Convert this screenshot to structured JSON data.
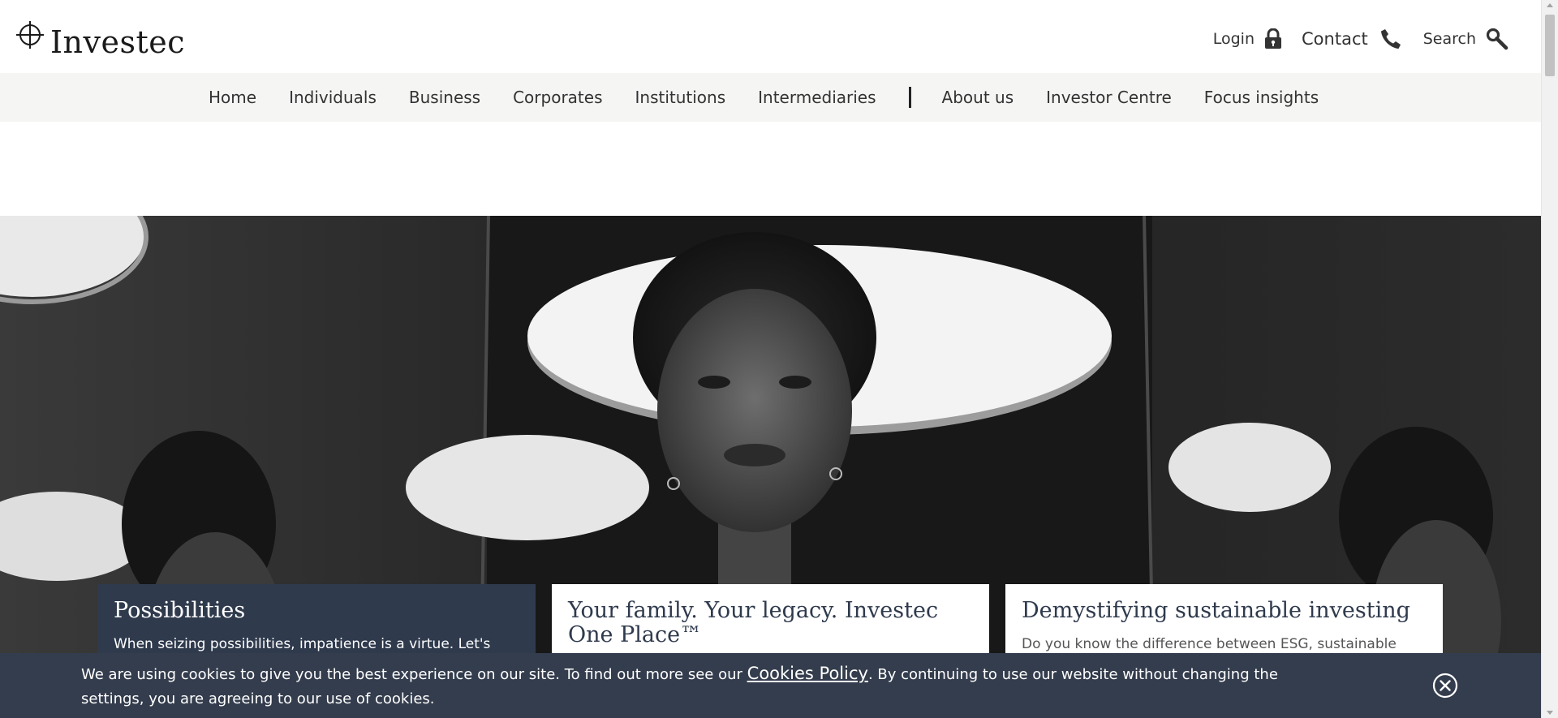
{
  "brand": {
    "name": "Investec"
  },
  "utility": {
    "login_label": "Login",
    "contact_label": "Contact",
    "search_label": "Search"
  },
  "nav": {
    "primary": [
      "Home",
      "Individuals",
      "Business",
      "Corporates",
      "Institutions",
      "Intermediaries"
    ],
    "secondary": [
      "About us",
      "Investor Centre",
      "Focus insights"
    ]
  },
  "cards": [
    {
      "title": "Possibilities",
      "body": "When seizing possibilities, impatience is a virtue. Let's"
    },
    {
      "title": "Your family. Your legacy. Investec One Place™",
      "body": ""
    },
    {
      "title": "Demystifying sustainable investing",
      "body": "Do you know the difference between ESG, sustainable"
    }
  ],
  "cookie": {
    "text_before": "We are using cookies to give you the best experience on our site. To find out more see our ",
    "link_label": "Cookies Policy",
    "text_after": ". By continuing to use our website without changing the settings, you are agreeing to our use of cookies."
  },
  "icons": {
    "logo": "crosshair-logo-icon",
    "login": "padlock-icon",
    "contact": "phone-icon",
    "search": "magnifier-icon",
    "close": "close-circle-icon"
  },
  "colors": {
    "nav_bg": "#f5f5f4",
    "card_dark": "#2f3a4d",
    "cookie_bg": "#343d4d",
    "text": "#2b2b2b"
  }
}
